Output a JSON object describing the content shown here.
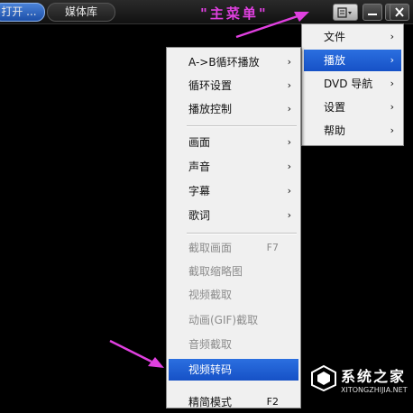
{
  "topbar": {
    "tab_open": "打开 ...",
    "tab_library": "媒体库",
    "menu_button_icon": "menu-icon",
    "minimize_icon": "minimize-icon",
    "maximize_icon": "maximize-icon",
    "close_icon": "close-icon"
  },
  "annotation": {
    "main_menu": "\"主菜单\"",
    "color": "#e040e0"
  },
  "main_menu": {
    "items": [
      {
        "label": "文件",
        "arrow": "›"
      },
      {
        "label": "播放",
        "arrow": "›"
      },
      {
        "label": "DVD 导航",
        "arrow": "›"
      },
      {
        "label": "设置",
        "arrow": "›"
      },
      {
        "label": "帮助",
        "arrow": "›"
      }
    ]
  },
  "play_menu": {
    "items": [
      {
        "label": "A->B循环播放",
        "arrow": "›"
      },
      {
        "label": "循环设置",
        "arrow": "›"
      },
      {
        "label": "播放控制",
        "arrow": "›"
      },
      {
        "label": "画面",
        "arrow": "›"
      },
      {
        "label": "声音",
        "arrow": "›"
      },
      {
        "label": "字幕",
        "arrow": "›"
      },
      {
        "label": "歌词",
        "arrow": "›"
      },
      {
        "label": "截取画面",
        "shortcut": "F7"
      },
      {
        "label": "截取缩略图"
      },
      {
        "label": "视频截取"
      },
      {
        "label": "动画(GIF)截取"
      },
      {
        "label": "音频截取"
      },
      {
        "label": "视频转码"
      },
      {
        "label": "精简模式",
        "shortcut": "F2"
      }
    ]
  },
  "watermark": {
    "title": "系统之家",
    "subtitle": "XITONGZHIJIA.NET"
  }
}
